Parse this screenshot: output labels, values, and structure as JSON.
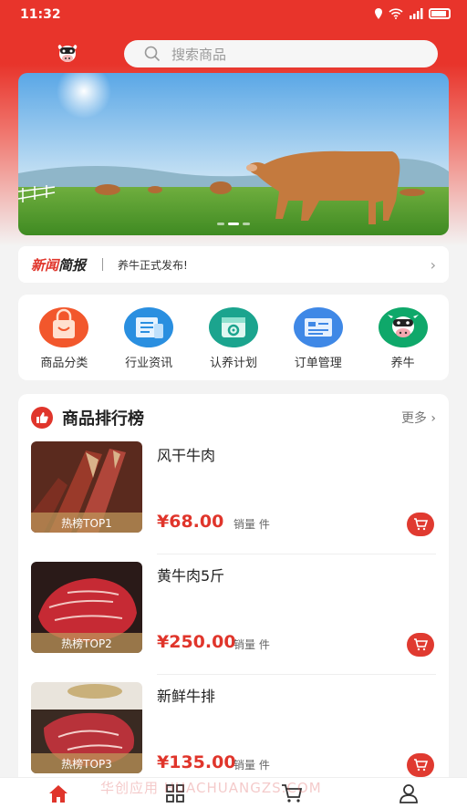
{
  "status_bar": {
    "time": "11:32"
  },
  "search": {
    "placeholder": "搜索商品"
  },
  "news": {
    "title_red": "新闻",
    "title_black": "简报",
    "text": "养牛正式发布!",
    "arrow": "›"
  },
  "categories": [
    {
      "label": "商品分类",
      "icon": "shopping-bag-icon"
    },
    {
      "label": "行业资讯",
      "icon": "news-card-icon"
    },
    {
      "label": "认养计划",
      "icon": "calendar-gear-icon"
    },
    {
      "label": "订单管理",
      "icon": "order-list-icon"
    },
    {
      "label": "养牛",
      "icon": "cow-icon"
    }
  ],
  "ranking": {
    "title": "商品排行榜",
    "more": "更多 ›",
    "products": [
      {
        "name": "风干牛肉",
        "price": "¥68.00",
        "sales": "销量 件",
        "tag": "热榜TOP1"
      },
      {
        "name": "黄牛肉5斤",
        "price": "¥250.00",
        "sales": "销量 件",
        "tag": "热榜TOP2"
      },
      {
        "name": "新鲜牛排",
        "price": "¥135.00",
        "sales": "销量 件",
        "tag": "热榜TOP3"
      }
    ]
  },
  "watermark": "华创应用 HUACHUANGZS.COM",
  "tabbar": [
    "home-icon",
    "grid-icon",
    "cart-icon",
    "user-icon"
  ],
  "colors": {
    "accent": "#e0352b",
    "header": "#e8342b",
    "background": "#f3f3f3"
  }
}
